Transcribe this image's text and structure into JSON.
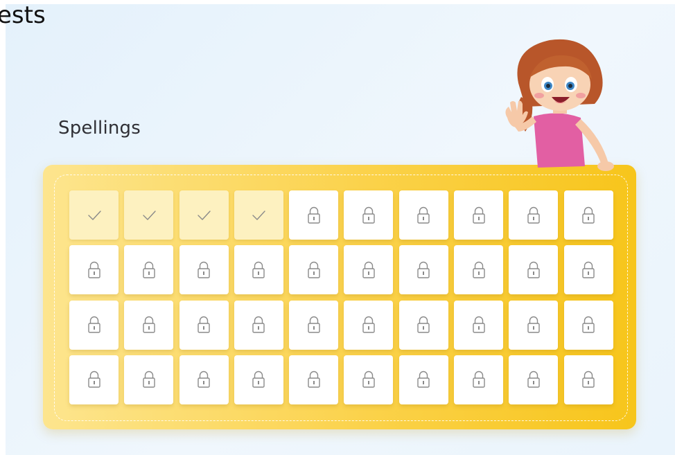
{
  "header": {
    "title_fragment": "ests"
  },
  "section": {
    "title": "Spellings"
  },
  "colors": {
    "board_start": "#fde58e",
    "board_end": "#f7c51b",
    "tile_unlocked": "#fdf1c0",
    "tile_locked": "#ffffff",
    "icon_stroke": "#8a8a8a"
  },
  "grid": {
    "rows": 4,
    "columns": 10,
    "tiles": [
      {
        "state": "completed",
        "icon": "checkmark-icon"
      },
      {
        "state": "completed",
        "icon": "checkmark-icon"
      },
      {
        "state": "completed",
        "icon": "checkmark-icon"
      },
      {
        "state": "completed",
        "icon": "checkmark-icon"
      },
      {
        "state": "locked",
        "icon": "lock-icon"
      },
      {
        "state": "locked",
        "icon": "lock-icon"
      },
      {
        "state": "locked",
        "icon": "lock-icon"
      },
      {
        "state": "locked",
        "icon": "lock-icon"
      },
      {
        "state": "locked",
        "icon": "lock-icon"
      },
      {
        "state": "locked",
        "icon": "lock-icon"
      },
      {
        "state": "locked",
        "icon": "lock-icon"
      },
      {
        "state": "locked",
        "icon": "lock-icon"
      },
      {
        "state": "locked",
        "icon": "lock-icon"
      },
      {
        "state": "locked",
        "icon": "lock-icon"
      },
      {
        "state": "locked",
        "icon": "lock-icon"
      },
      {
        "state": "locked",
        "icon": "lock-icon"
      },
      {
        "state": "locked",
        "icon": "lock-icon"
      },
      {
        "state": "locked",
        "icon": "lock-icon"
      },
      {
        "state": "locked",
        "icon": "lock-icon"
      },
      {
        "state": "locked",
        "icon": "lock-icon"
      },
      {
        "state": "locked",
        "icon": "lock-icon"
      },
      {
        "state": "locked",
        "icon": "lock-icon"
      },
      {
        "state": "locked",
        "icon": "lock-icon"
      },
      {
        "state": "locked",
        "icon": "lock-icon"
      },
      {
        "state": "locked",
        "icon": "lock-icon"
      },
      {
        "state": "locked",
        "icon": "lock-icon"
      },
      {
        "state": "locked",
        "icon": "lock-icon"
      },
      {
        "state": "locked",
        "icon": "lock-icon"
      },
      {
        "state": "locked",
        "icon": "lock-icon"
      },
      {
        "state": "locked",
        "icon": "lock-icon"
      },
      {
        "state": "locked",
        "icon": "lock-icon"
      },
      {
        "state": "locked",
        "icon": "lock-icon"
      },
      {
        "state": "locked",
        "icon": "lock-icon"
      },
      {
        "state": "locked",
        "icon": "lock-icon"
      },
      {
        "state": "locked",
        "icon": "lock-icon"
      },
      {
        "state": "locked",
        "icon": "lock-icon"
      },
      {
        "state": "locked",
        "icon": "lock-icon"
      },
      {
        "state": "locked",
        "icon": "lock-icon"
      },
      {
        "state": "locked",
        "icon": "lock-icon"
      },
      {
        "state": "locked",
        "icon": "lock-icon"
      }
    ]
  },
  "mascot": {
    "icon": "waving-girl-illustration"
  }
}
